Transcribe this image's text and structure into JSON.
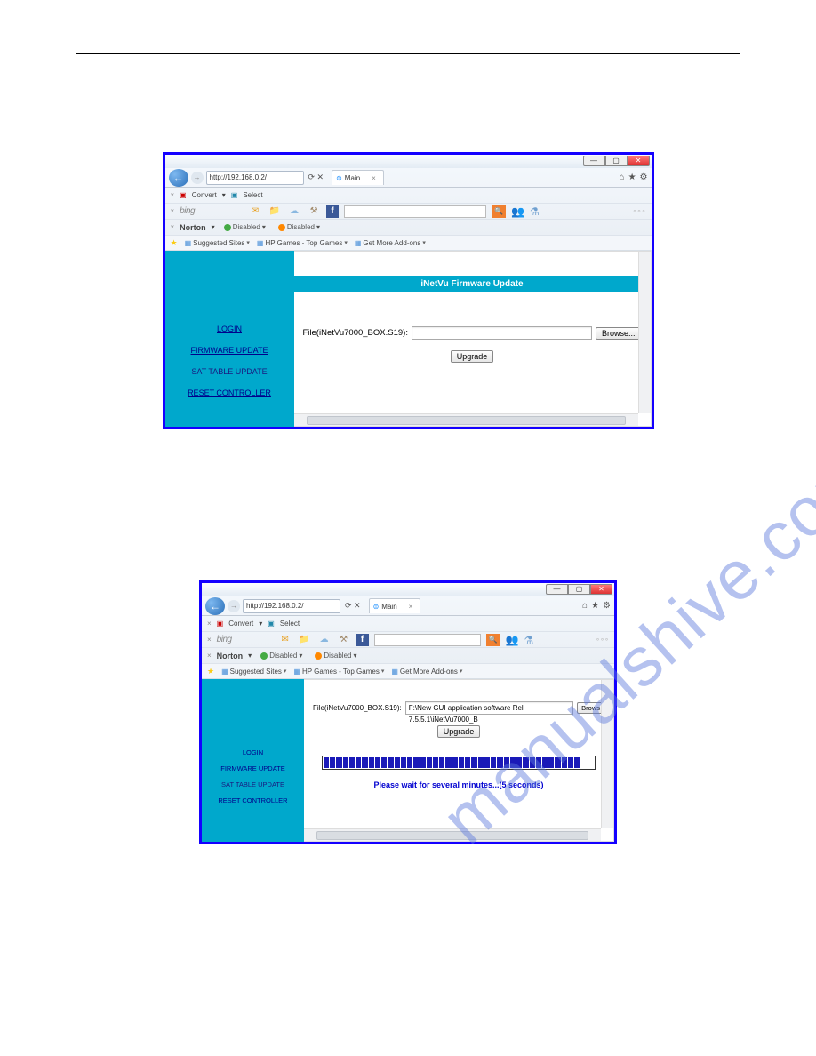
{
  "watermark": "manualshive.com",
  "browser": {
    "url": "http://192.168.0.2/",
    "refresh_hint": "⟳ ✕",
    "tab_title": "Main",
    "back_glyph": "←",
    "fwd_glyph": "→",
    "convert_label": "Convert",
    "select_label": "Select",
    "bing_label": "bing",
    "norton_label": "Norton",
    "disabled_label": "Disabled",
    "favorites": {
      "suggested": "Suggested Sites",
      "hp_games": "HP Games - Top Games",
      "addons": "Get More Add-ons"
    },
    "window_controls": {
      "min": "—",
      "max": "▢",
      "close": "✕"
    },
    "gear": "⚙",
    "home": "⌂",
    "star": "★"
  },
  "sidebar": {
    "login": "LOGIN",
    "firmware": "FIRMWARE UPDATE",
    "sat_table": "SAT TABLE UPDATE",
    "reset": "RESET CONTROLLER"
  },
  "shot1": {
    "header": "iNetVu Firmware Update",
    "file_label": "File(iNetVu7000_BOX.S19):",
    "file_value": "",
    "browse_label": "Browse...",
    "upgrade_label": "Upgrade"
  },
  "shot2": {
    "file_label": "File(iNetVu7000_BOX.S19):",
    "file_value": "F:\\New GUI application software Rel 7.5.5.1\\iNetVu7000_B",
    "browse_label": "Brows",
    "upgrade_label": "Upgrade",
    "wait_message": "Please wait for several minutes...(5 seconds)"
  }
}
